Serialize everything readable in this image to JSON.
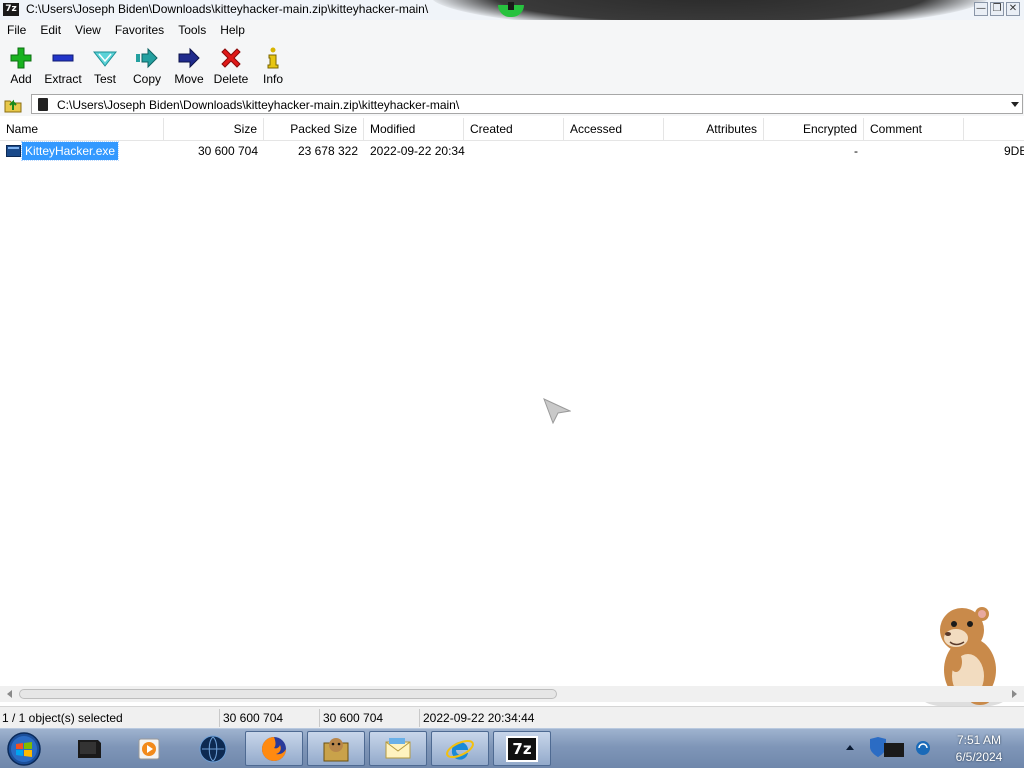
{
  "window": {
    "title": "C:\\Users\\Joseph Biden\\Downloads\\kitteyhacker-main.zip\\kitteyhacker-main\\",
    "app_icon_text": "7z"
  },
  "menu": [
    "File",
    "Edit",
    "View",
    "Favorites",
    "Tools",
    "Help"
  ],
  "toolbar": [
    {
      "label": "Add",
      "icon": "plus-icon"
    },
    {
      "label": "Extract",
      "icon": "minus-icon"
    },
    {
      "label": "Test",
      "icon": "check-icon"
    },
    {
      "label": "Copy",
      "icon": "copy-arrow-icon"
    },
    {
      "label": "Move",
      "icon": "move-arrow-icon"
    },
    {
      "label": "Delete",
      "icon": "delete-x-icon"
    },
    {
      "label": "Info",
      "icon": "info-icon"
    }
  ],
  "address": {
    "path": "C:\\Users\\Joseph Biden\\Downloads\\kitteyhacker-main.zip\\kitteyhacker-main\\"
  },
  "columns": [
    "Name",
    "Size",
    "Packed Size",
    "Modified",
    "Created",
    "Accessed",
    "Attributes",
    "Encrypted",
    "Comment"
  ],
  "rows": [
    {
      "name": "KitteyHacker.exe",
      "size": "30 600 704",
      "packed": "23 678 322",
      "modified": "2022-09-22 20:34",
      "created": "",
      "accessed": "",
      "attributes": "",
      "encrypted": "-",
      "comment": "",
      "crc": "9DE"
    }
  ],
  "status": {
    "selection": "1 / 1 object(s) selected",
    "size": "30 600 704",
    "packed": "30 600 704",
    "modified": "2022-09-22 20:34:44"
  },
  "taskbar": {
    "items": [
      "terminal-app",
      "media-player",
      "network-app",
      "firefox",
      "sandbox-box",
      "mail-app",
      "internet-explorer",
      "7zip"
    ],
    "time": "7:51 AM",
    "date": "6/5/2024",
    "active_app_label": "7z"
  },
  "colors": {
    "selection": "#3399ff",
    "taskbar": "#7f96b8"
  }
}
